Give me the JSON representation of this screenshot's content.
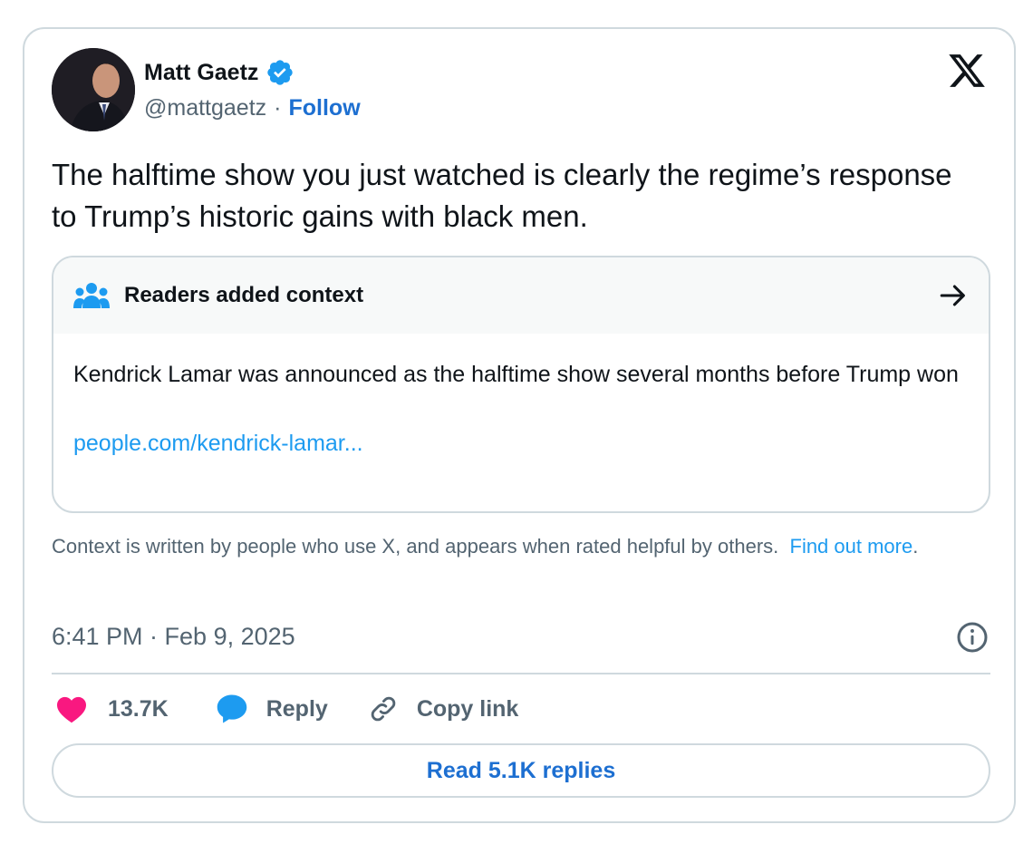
{
  "author": {
    "name": "Matt Gaetz",
    "handle": "@mattgaetz",
    "separator": "·",
    "follow_label": "Follow"
  },
  "tweet": {
    "text": "The halftime show you just watched is clearly the regime’s response to Trump’s historic gains with black men.",
    "timestamp": "6:41 PM · Feb 9, 2025"
  },
  "community_note": {
    "title": "Readers added context",
    "body": "Kendrick Lamar was announced as the halftime show several months before Trump won",
    "link_text": "people.com/kendrick-lamar..."
  },
  "disclaimer": {
    "text": "Context is written by people who use X, and appears when rated helpful by others.",
    "link_text": "Find out more",
    "trailing": "."
  },
  "actions": {
    "likes": "13.7K",
    "reply_label": "Reply",
    "copy_label": "Copy link"
  },
  "read_replies_label": "Read 5.1K replies",
  "colors": {
    "link_blue": "#1d9bf0",
    "follow_blue": "#1d6fd1",
    "like_pink": "#f91880",
    "reply_blue": "#1d9bf0",
    "verified_blue": "#1d9bf0",
    "muted_text": "#536471",
    "border": "#cfd9de"
  },
  "icons": {
    "verified": "verified-badge-icon",
    "logo": "x-logo-icon",
    "notes": "people-group-icon",
    "arrow": "arrow-right-icon",
    "info": "info-icon",
    "like": "heart-icon",
    "reply": "speech-bubble-icon",
    "copy": "link-icon"
  }
}
